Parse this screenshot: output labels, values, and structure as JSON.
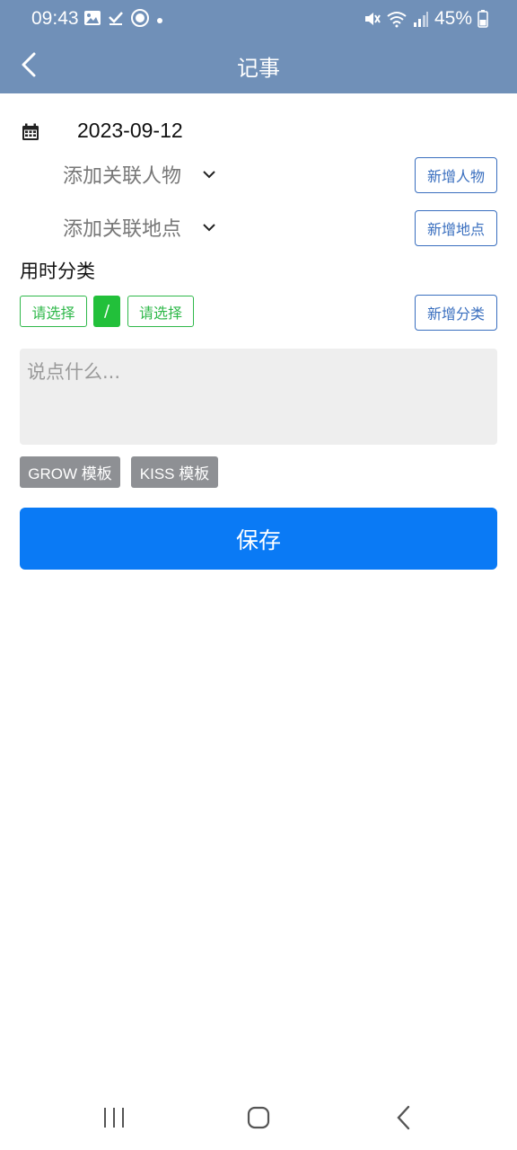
{
  "status_bar": {
    "time": "09:43",
    "battery": "45%",
    "left_icons": [
      "image-icon",
      "check-icon",
      "sync-icon",
      "dot-icon"
    ],
    "right_icons": [
      "mute-icon",
      "wifi-icon",
      "signal-icon",
      "battery-icon"
    ]
  },
  "header": {
    "title": "记事",
    "back_icon": "back-arrow-icon",
    "background": "#7090b8"
  },
  "form": {
    "date": "2023-09-12",
    "date_icon": "calendar-icon",
    "person_select": "添加关联人物",
    "place_select": "添加关联地点",
    "add_person_label": "新增人物",
    "add_place_label": "新增地点",
    "category_section_label": "用时分类",
    "category_primary": "请选择",
    "category_separator": "/",
    "category_secondary": "请选择",
    "add_category_label": "新增分类",
    "note_placeholder": "说点什么...",
    "note_value": "",
    "templates": [
      "GROW 模板",
      "KISS 模板"
    ],
    "save_label": "保存"
  },
  "colors": {
    "accent_blue": "#0a7af5",
    "outline_blue": "#3a6fbf",
    "category_green": "#2fb84a",
    "template_gray": "#8e9094"
  },
  "nav_bar": {
    "items": [
      "recent-apps-icon",
      "home-icon",
      "back-icon"
    ]
  }
}
